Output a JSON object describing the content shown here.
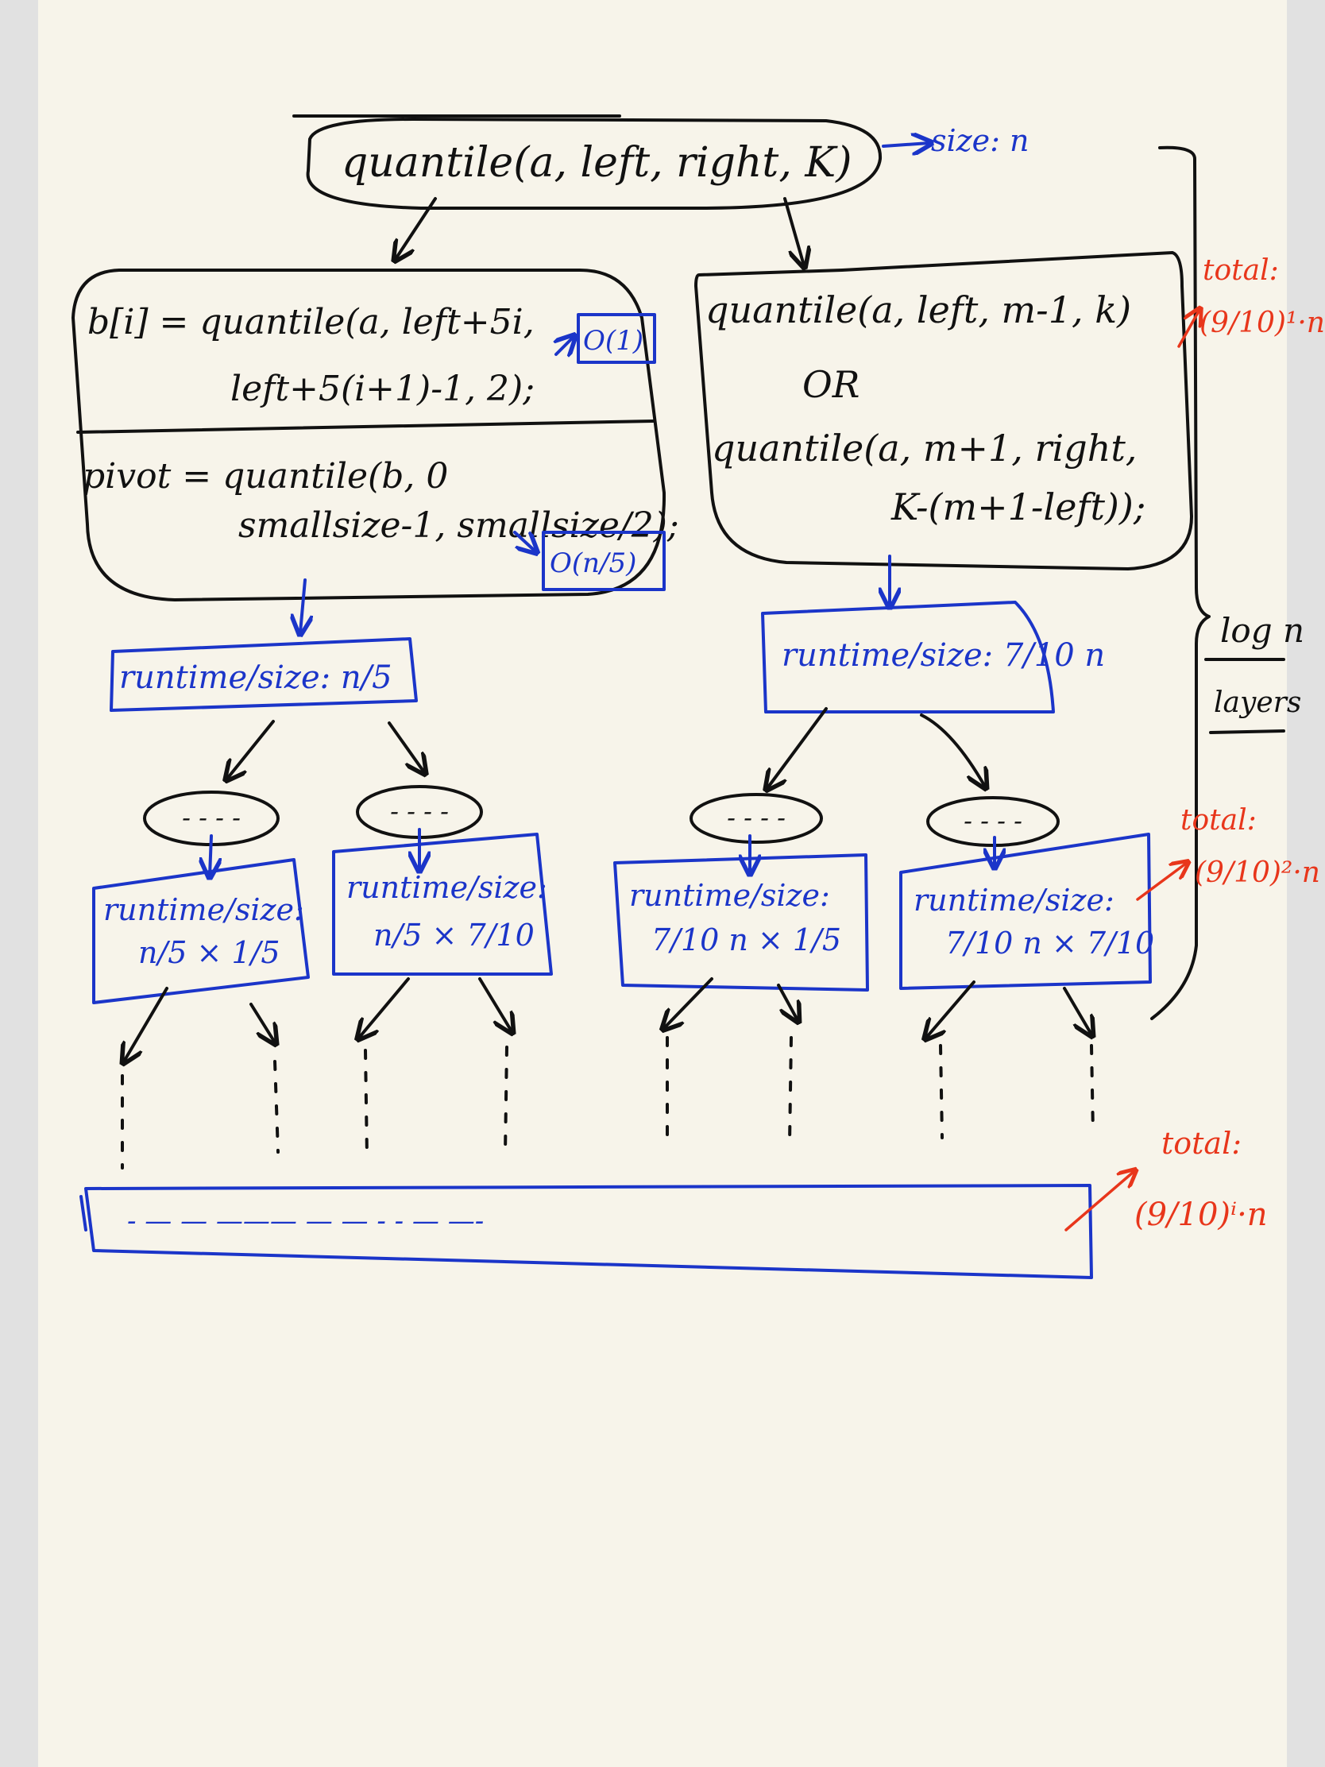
{
  "root": {
    "call": "quantile(a, left, right, K)",
    "size_label": "size: n"
  },
  "left_node": {
    "line1": "b[i] = quantile(a, left+5i,",
    "line2": "left+5(i+1)-1, 2);",
    "tag1": "O(1)",
    "line3": "pivot = quantile(b, 0",
    "line4": "smallsize-1, smallsize/2);",
    "tag2": "O(n/5)"
  },
  "right_node": {
    "line1": "quantile(a, left, m-1, k)",
    "line2": "OR",
    "line3": "quantile(a, m+1, right,",
    "line4": "K-(m+1-left));"
  },
  "level1": {
    "left": "runtime/size: n/5",
    "right": "runtime/size: 7/10 n"
  },
  "level2": {
    "ellipse": "- - - -",
    "boxes": [
      {
        "line1": "runtime/size:",
        "line2": "n/5 × 1/5"
      },
      {
        "line1": "runtime/size:",
        "line2": "n/5 × 7/10"
      },
      {
        "line1": "runtime/size:",
        "line2": "7/10 n × 1/5"
      },
      {
        "line1": "runtime/size:",
        "line2": "7/10 n × 7/10"
      }
    ]
  },
  "bottom_bar": "- — — ——— — — - - — —-",
  "side": {
    "total_label": "total:",
    "total1": "(9/10)¹·n",
    "total2": "(9/10)²·n",
    "total3": "(9/10)ⁱ·n",
    "layers_top": "log n",
    "layers_bottom": "layers"
  },
  "colors": {
    "ink_black": "#111111",
    "ink_blue": "#1b35c9",
    "ink_red": "#e8361b",
    "paper": "#f7f4ea",
    "margin": "#e1e1e1"
  }
}
